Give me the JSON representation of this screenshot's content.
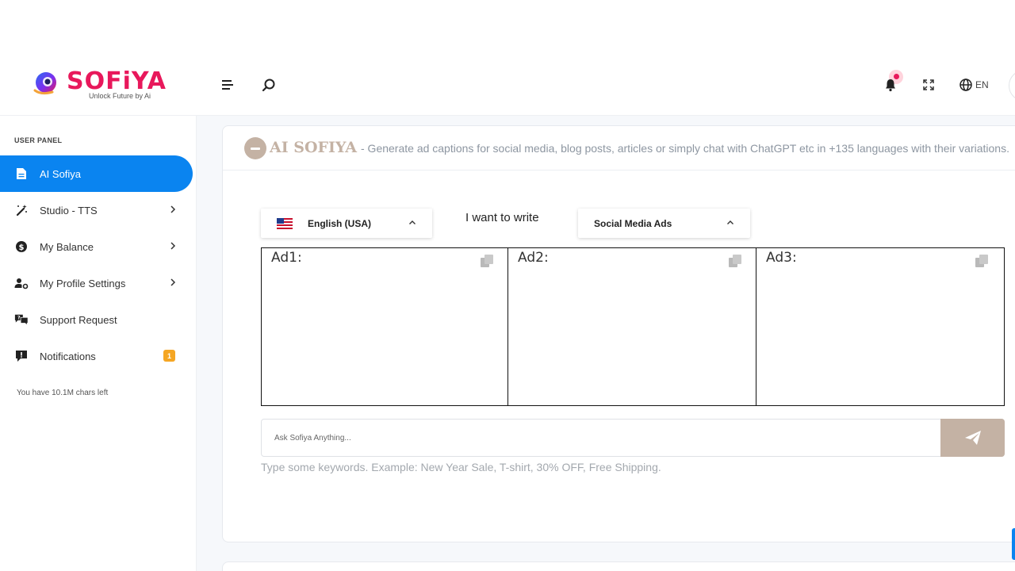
{
  "brand": {
    "logo_word": "SOFiYA",
    "tagline": "Unlock Future by Ai",
    "accent_color": "#e8185b",
    "primary_color": "#0a84f0",
    "muted_brand_color": "#c4b2a4"
  },
  "header": {
    "icons": [
      "hamburger-menu-icon",
      "search-icon",
      "bell-icon",
      "fullscreen-icon",
      "globe-icon"
    ],
    "language": "EN"
  },
  "sidebar": {
    "section_label": "USER PANEL",
    "items": [
      {
        "label": "AI Sofiya",
        "icon": "document-icon",
        "active": true
      },
      {
        "label": "Studio - TTS",
        "icon": "magic-wand-icon",
        "has_submenu": true
      },
      {
        "label": "My Balance",
        "icon": "dollar-coin-icon",
        "has_submenu": true
      },
      {
        "label": "My Profile Settings",
        "icon": "user-gear-icon",
        "has_submenu": true
      },
      {
        "label": "Support Request",
        "icon": "chat-question-icon"
      },
      {
        "label": "Notifications",
        "icon": "alert-message-icon",
        "badge": "1"
      }
    ],
    "chars_left": "You have 10.1M chars left"
  },
  "main": {
    "card_title": "AI SOFIYA",
    "card_description": "- Generate ad captions for social media, blog posts, articles or simply chat with ChatGPT etc in +135 languages with their variations.",
    "language_select": {
      "value": "English (USA)",
      "flag": "us-flag-icon"
    },
    "want_label": "I want to write",
    "type_select": {
      "value": "Social Media Ads"
    },
    "ads": [
      {
        "label": "Ad1:"
      },
      {
        "label": "Ad2:"
      },
      {
        "label": "Ad3:"
      }
    ],
    "ask": {
      "placeholder": "Ask Sofiya Anything...",
      "value": ""
    },
    "hint": "Type some keywords. Example: New Year Sale, T-shirt, 30% OFF, Free Shipping."
  }
}
